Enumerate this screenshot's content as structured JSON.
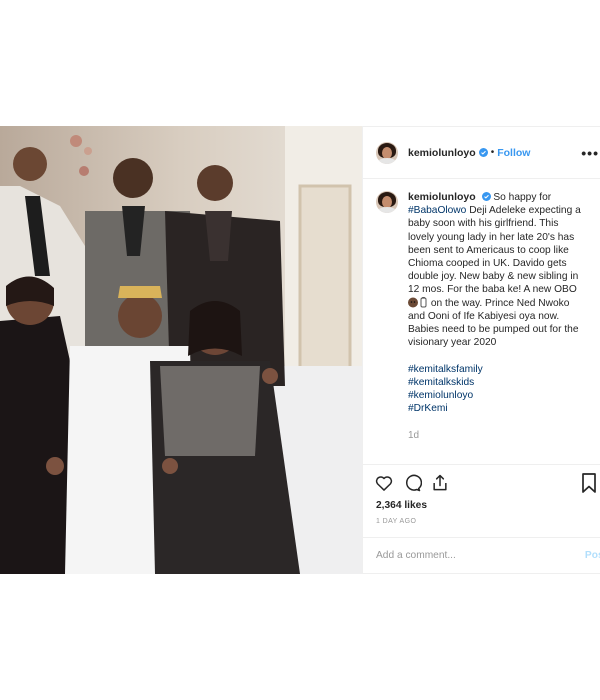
{
  "header": {
    "username": "kemiolunloyo",
    "separator": "•",
    "follow_label": "Follow",
    "more_label": "•••"
  },
  "caption": {
    "username": "kemiolunloyo",
    "lines": [
      "So happy for",
      "Deji Adeleke expecting a",
      "baby soon with his girlfriend. This",
      "lovely young lady in her late 20's has",
      "been sent to Americaus to coop like",
      "Chioma cooped in UK. Davido gets",
      "double joy. New baby & new sibling in",
      "12 mos. For the baba ke! A new OBO",
      "on the way. Prince Ned Nwoko",
      "and Ooni of Ife Kabiyesi oya now.",
      "Babies need to be pumped out for the",
      "visionary year 2020"
    ],
    "inline_hashtag": "#BabaOlowo",
    "hashtags": [
      "#kemitalksfamily",
      "#kemitalkskids",
      "#kemiolunloyo",
      "#DrKemi"
    ],
    "time": "1d"
  },
  "actions": {
    "likes": "2,364 likes",
    "ago": "1 DAY AGO",
    "comment_placeholder": "Add a comment...",
    "post_label": "Post"
  },
  "icons": [
    "heart-icon",
    "comment-icon",
    "share-icon",
    "bookmark-icon",
    "verified-icon",
    "more-icon"
  ],
  "colors": {
    "link_blue": "#3897f0",
    "hashtag": "#003569",
    "muted": "#999999",
    "text": "#262626",
    "border": "#efefef"
  }
}
